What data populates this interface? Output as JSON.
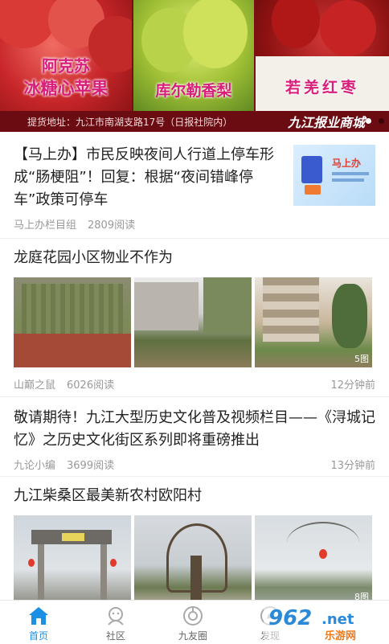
{
  "banner": {
    "panels": [
      {
        "line1": "阿克苏",
        "line2": "冰糖心苹果"
      },
      {
        "line1": "库尔勒香梨"
      },
      {
        "line1": "若羌红枣"
      }
    ],
    "address": "提货地址：九江市南湖支路17号（日报社院内）",
    "brand": "九江报业商城"
  },
  "articles": [
    {
      "title": "【马上办】市民反映夜间人行道上停车形成“肠梗阻”！回复：根据“夜间错峰停车”政策可停车",
      "source": "马上办栏目组",
      "reads": "2809阅读",
      "thumb_text": "马上办"
    },
    {
      "title": "龙庭花园小区物业不作为",
      "source": "山巅之鼠",
      "reads": "6026阅读",
      "time": "12分钟前",
      "badge": "5图"
    },
    {
      "title": "敬请期待！九江大型历史文化普及视频栏目——《浔城记忆》之历史文化街区系列即将重磅推出",
      "source": "九论小编",
      "reads": "3699阅读",
      "time": "13分钟前"
    },
    {
      "title": "九江柴桑区最美新农村欧阳村",
      "badge": "8图"
    }
  ],
  "tabs": [
    {
      "label": "首页",
      "icon": "home-icon",
      "active": true
    },
    {
      "label": "社区",
      "icon": "community-icon"
    },
    {
      "label": "九友圈",
      "icon": "circle-icon"
    },
    {
      "label": "发现",
      "icon": "discover-icon"
    }
  ],
  "watermark": {
    "text1": "962",
    "text2": ".net",
    "text3": "乐游网"
  },
  "colors": {
    "accent": "#1a8fe3",
    "banner_bar": "#6b0c12",
    "muted": "#999999"
  }
}
